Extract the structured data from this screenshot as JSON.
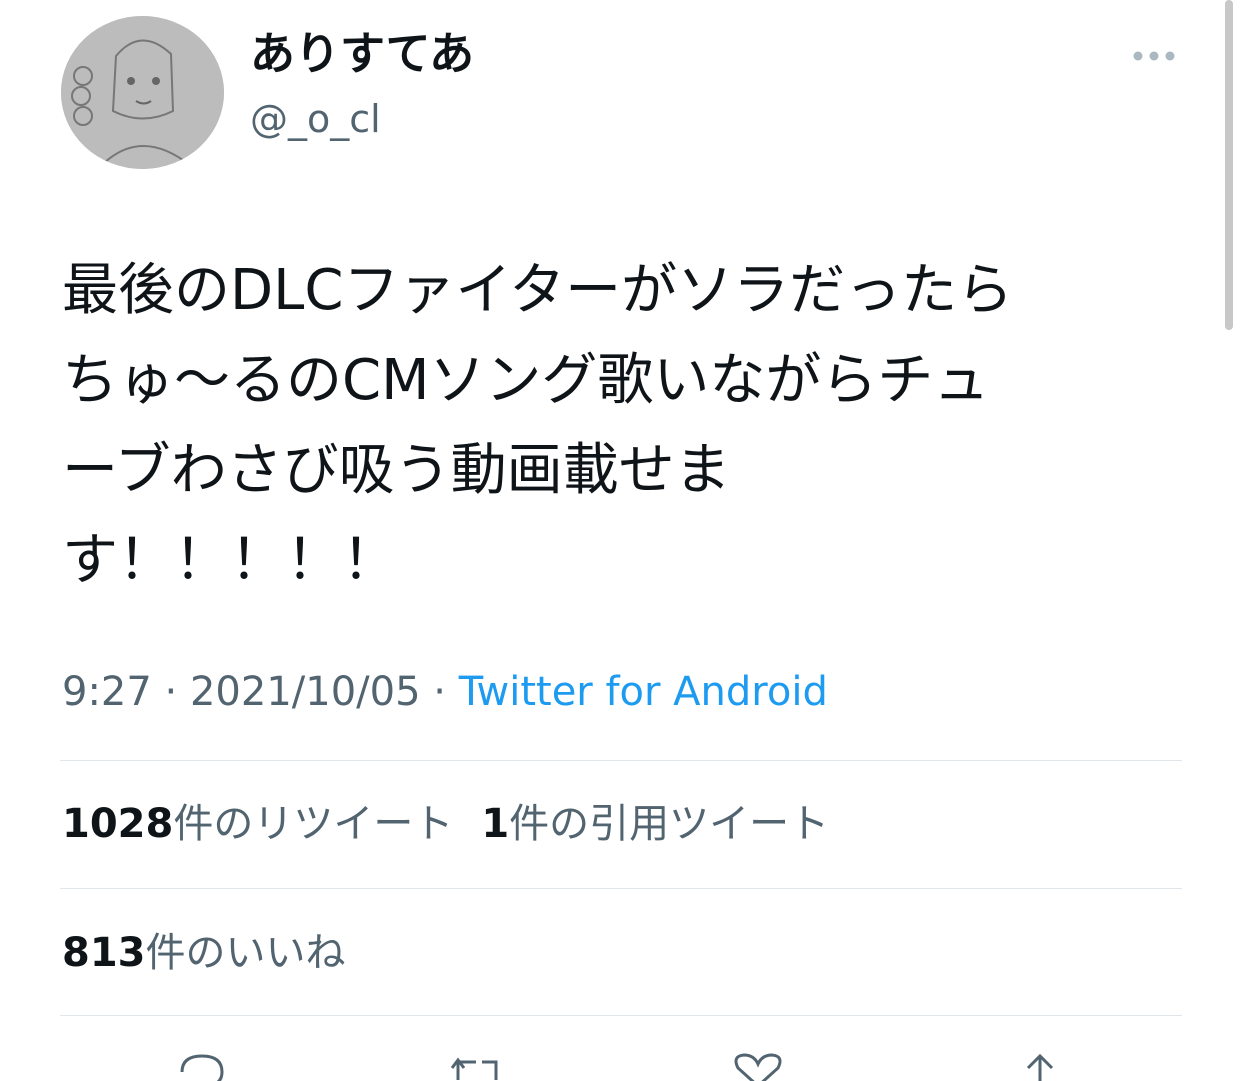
{
  "author": {
    "display_name": "ありすてあ",
    "handle": "@_o_cl",
    "avatar_icon": "avatar-drawing"
  },
  "tweet": {
    "lines": [
      "最後のDLCファイターがソラだったら",
      "ちゅ〜るのCMソング歌いながらチュ",
      "ーブわさび吸う動画載せま",
      "す！！！！！"
    ],
    "time": "9:27",
    "date": "2021/10/05",
    "separator": "·",
    "source": "Twitter for Android"
  },
  "stats": {
    "retweets_count": "1028",
    "retweets_label": "件のリツイート",
    "quotes_count": "1",
    "quotes_label": "件の引用ツイート",
    "likes_count": "813",
    "likes_label": "件のいいね"
  },
  "actions": [
    {
      "name": "reply",
      "icon": "reply-icon"
    },
    {
      "name": "retweet",
      "icon": "retweet-icon"
    },
    {
      "name": "like",
      "icon": "heart-icon"
    },
    {
      "name": "share",
      "icon": "share-icon"
    }
  ],
  "colors": {
    "text": "#0f1419",
    "secondary": "#536471",
    "accent": "#1d9bf0",
    "divider": "#e1e6ea"
  }
}
